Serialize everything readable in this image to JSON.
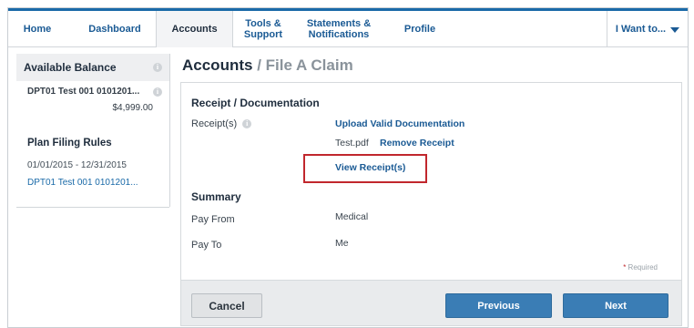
{
  "nav": {
    "items": [
      {
        "label": "Home"
      },
      {
        "label": "Dashboard"
      },
      {
        "label": "Accounts"
      },
      {
        "label": "Tools & Support"
      },
      {
        "label": "Statements & Notifications"
      },
      {
        "label": "Profile"
      }
    ],
    "i_want_to": "I Want to..."
  },
  "sidebar": {
    "balance_title": "Available Balance",
    "account_name": "DPT01 Test 001 0101201...",
    "account_balance": "$4,999.00",
    "rules_title": "Plan Filing Rules",
    "rules_dates": "01/01/2015 - 12/31/2015",
    "rules_link": "DPT01 Test 001 0101201..."
  },
  "page": {
    "title": "Accounts",
    "title_sep": " / ",
    "subtitle": "File A Claim"
  },
  "receipt": {
    "section_title": "Receipt / Documentation",
    "field_label": "Receipt(s)",
    "upload_link": "Upload Valid Documentation",
    "file_name": "Test.pdf",
    "remove_link": "Remove Receipt",
    "view_link": "View Receipt(s)"
  },
  "summary": {
    "section_title": "Summary",
    "pay_from_label": "Pay From",
    "pay_from_value": "Medical",
    "pay_to_label": "Pay To",
    "pay_to_value": "Me"
  },
  "required_note": {
    "star": "*",
    "text": " Required"
  },
  "buttons": {
    "cancel": "Cancel",
    "previous": "Previous",
    "next": "Next"
  },
  "colors": {
    "accent": "#1a6aa8",
    "button_primary": "#3a7db5",
    "highlight": "#c1272d"
  }
}
